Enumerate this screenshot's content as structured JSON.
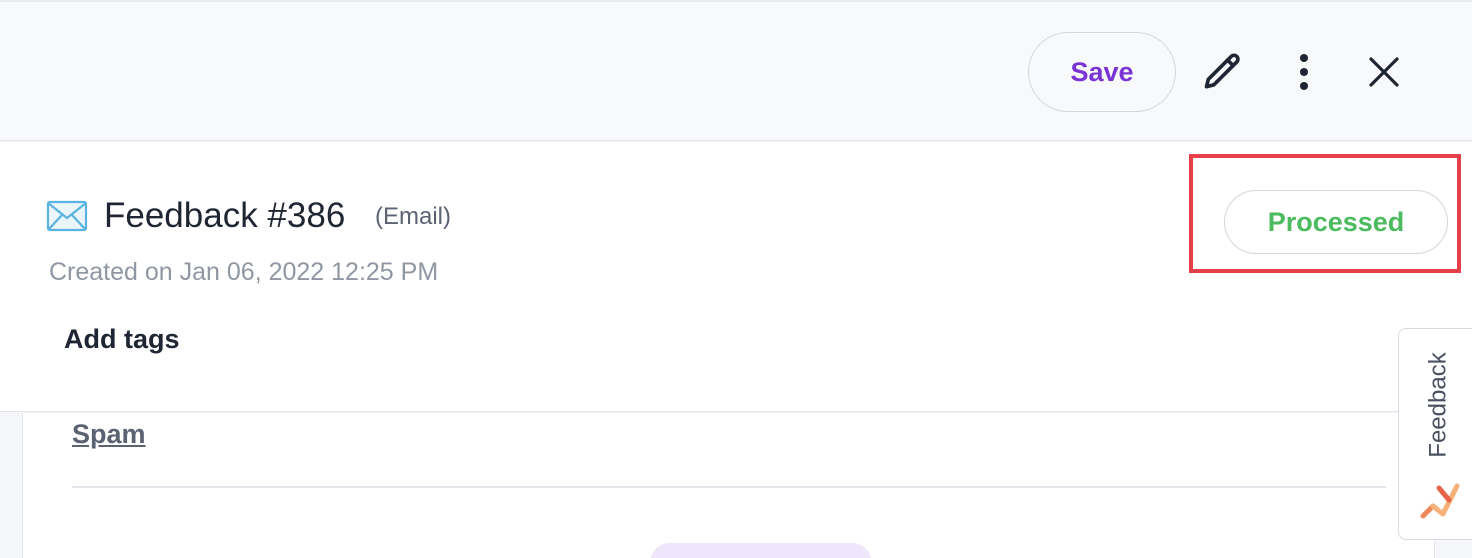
{
  "toolbar": {
    "save_label": "Save",
    "edit_icon": "pencil-icon",
    "more_icon": "kebab-menu-icon",
    "close_icon": "close-icon"
  },
  "ticket": {
    "icon": "envelope-icon",
    "title": "Feedback #386",
    "channel": "(Email)",
    "created": "Created on Jan 06, 2022 12:25 PM",
    "status": "Processed",
    "add_tags_label": "Add tags"
  },
  "content": {
    "spam_label": "Spam"
  },
  "feedback_tab": {
    "label": "Feedback",
    "logo_icon": "feedback-logo-icon"
  },
  "colors": {
    "accent": "#7a34d6",
    "status_processed": "#4cbb5f",
    "highlight": "#e5404a",
    "mail_icon": "#5ab3e0"
  }
}
